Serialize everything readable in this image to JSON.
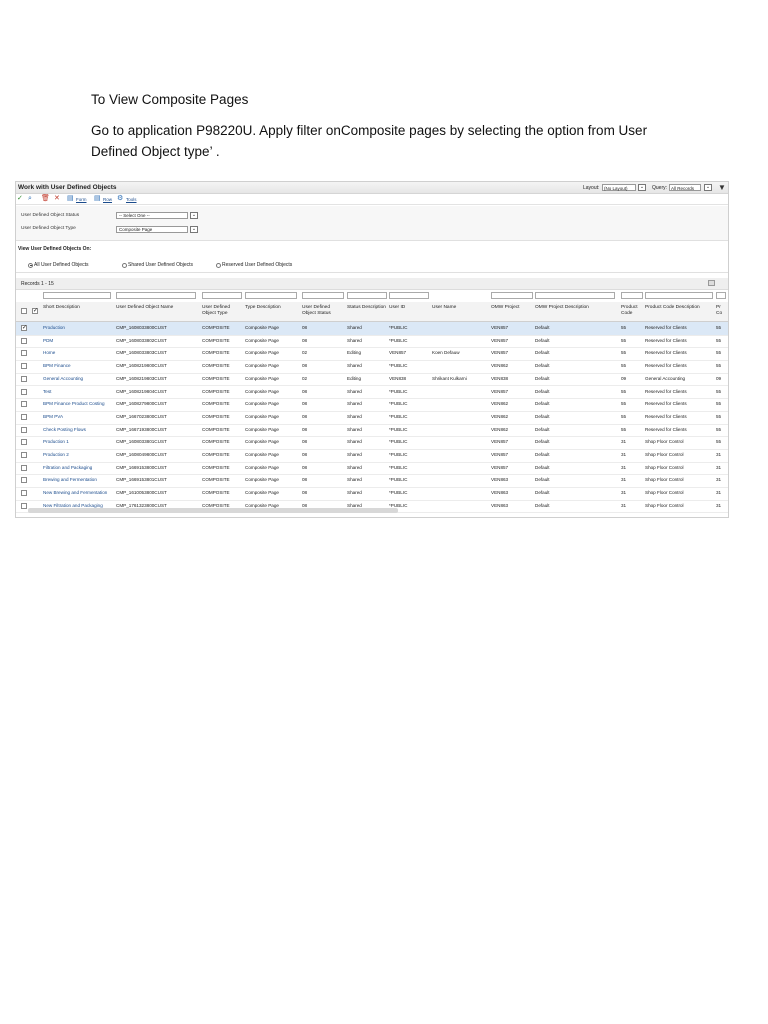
{
  "doc": {
    "heading": "To View Composite Pages",
    "instruction": "Go to application P98220U. Apply filter onComposite pages by selecting the option from User Defined Object type’ ."
  },
  "app": {
    "title": "Work with User Defined Objects",
    "layout_label": "Layout:",
    "layout_value": "(No Layout)",
    "query_label": "Query:",
    "query_value": "All Records",
    "toolbar": {
      "form": "Form",
      "row": "Row",
      "tools": "Tools"
    },
    "filters": [
      {
        "label": "User Defined Object Status",
        "value": "-- Select One --"
      },
      {
        "label": "User Defined Object Type",
        "value": "Composite Page"
      }
    ],
    "view_on_label": "View User Defined Objects On:",
    "radios": [
      {
        "label": "All User Defined Objects",
        "selected": true
      },
      {
        "label": "Shared User Defined Objects",
        "selected": false
      },
      {
        "label": "Reserved User Defined Objects",
        "selected": false
      }
    ],
    "records_label": "Records 1 - 15",
    "columns": [
      "Short Description",
      "User Defined Object Name",
      "User Defined Object Type",
      "Type Description",
      "User Defined Object Status",
      "Status Description",
      "User ID",
      "User Name",
      "OMW Project",
      "OMW Project Description",
      "Product Code",
      "Product Code Description",
      "Pr Co"
    ],
    "rows": [
      [
        "Production",
        "CMP_1608033800CUST",
        "COMPOSITE",
        "Composite Page",
        "08",
        "Shared",
        "*PUBLIC",
        "",
        "VEN857",
        "Default",
        "55",
        "Reserved for Clients",
        "55"
      ],
      [
        "PDM",
        "CMP_1608033802CUST",
        "COMPOSITE",
        "Composite Page",
        "08",
        "Shared",
        "*PUBLIC",
        "",
        "VEN857",
        "Default",
        "55",
        "Reserved for Clients",
        "55"
      ],
      [
        "Home",
        "CMP_1608033803CUST",
        "COMPOSITE",
        "Composite Page",
        "02",
        "Editing",
        "VEN857",
        "Koen Defauw",
        "VEN857",
        "Default",
        "55",
        "Reserved for Clients",
        "55"
      ],
      [
        "BPM Finance",
        "CMP_1608219800CUST",
        "COMPOSITE",
        "Composite Page",
        "08",
        "Shared",
        "*PUBLIC",
        "",
        "VEN862",
        "Default",
        "55",
        "Reserved for Clients",
        "55"
      ],
      [
        "General Accounting",
        "CMP_1608219803CUST",
        "COMPOSITE",
        "Composite Page",
        "02",
        "Editing",
        "VEN838",
        "Shrikant Kulkarni",
        "VEN838",
        "Default",
        "09",
        "General Accounting",
        "09"
      ],
      [
        "Test",
        "CMP_1608219804CUST",
        "COMPOSITE",
        "Composite Page",
        "08",
        "Shared",
        "*PUBLIC",
        "",
        "VEN857",
        "Default",
        "55",
        "Reserved for Clients",
        "55"
      ],
      [
        "BPM Finance Product Costing",
        "CMP_1608279800CUST",
        "COMPOSITE",
        "Composite Page",
        "08",
        "Shared",
        "*PUBLIC",
        "",
        "VEN862",
        "Default",
        "55",
        "Reserved for Clients",
        "55"
      ],
      [
        "BPM PVA",
        "CMP_1667023800CUST",
        "COMPOSITE",
        "Composite Page",
        "08",
        "Shared",
        "*PUBLIC",
        "",
        "VEN862",
        "Default",
        "55",
        "Reserved for Clients",
        "55"
      ],
      [
        "Check Posting Flows",
        "CMP_1667193800CUST",
        "COMPOSITE",
        "Composite Page",
        "08",
        "Shared",
        "*PUBLIC",
        "",
        "VEN862",
        "Default",
        "55",
        "Reserved for Clients",
        "55"
      ],
      [
        "Production 1",
        "CMP_1608033801CUST",
        "COMPOSITE",
        "Composite Page",
        "08",
        "Shared",
        "*PUBLIC",
        "",
        "VEN857",
        "Default",
        "31",
        "Shop Floor Control",
        "55"
      ],
      [
        "Production 2",
        "CMP_1608049800CUST",
        "COMPOSITE",
        "Composite Page",
        "08",
        "Shared",
        "*PUBLIC",
        "",
        "VEN857",
        "Default",
        "31",
        "Shop Floor Control",
        "31"
      ],
      [
        "Filtration and Packaging",
        "CMP_1669153800CUST",
        "COMPOSITE",
        "Composite Page",
        "08",
        "Shared",
        "*PUBLIC",
        "",
        "VEN857",
        "Default",
        "31",
        "Shop Floor Control",
        "31"
      ],
      [
        "Brewing and Fermentation",
        "CMP_1669153801CUST",
        "COMPOSITE",
        "Composite Page",
        "08",
        "Shared",
        "*PUBLIC",
        "",
        "VEN863",
        "Default",
        "31",
        "Shop Floor Control",
        "31"
      ],
      [
        "New Brewing and Fermentation",
        "CMP_1610053800CUST",
        "COMPOSITE",
        "Composite Page",
        "08",
        "Shared",
        "*PUBLIC",
        "",
        "VEN863",
        "Default",
        "31",
        "Shop Floor Control",
        "31"
      ],
      [
        "New Filtration and Packaging",
        "CMP_1761323800CUST",
        "COMPOSITE",
        "Composite Page",
        "08",
        "Shared",
        "*PUBLIC",
        "",
        "VEN863",
        "Default",
        "31",
        "Shop Floor Control",
        "31"
      ]
    ]
  }
}
